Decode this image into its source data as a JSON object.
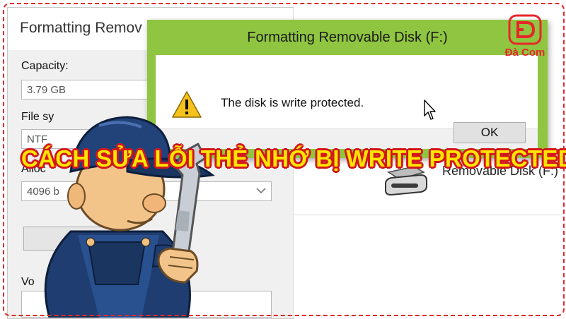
{
  "format_window": {
    "title": "Formatting Remov",
    "capacity_label": "Capacity:",
    "capacity_value": "3.79 GB",
    "filesystem_label": "File sy",
    "filesystem_value": "NTF",
    "allocation_label": "Alloc",
    "allocation_value": "4096 b",
    "volume_label": "Vo"
  },
  "explorer": {
    "drive_label": "Removable Disk (F:)"
  },
  "dialog": {
    "title": "Formatting Removable Disk (F:)",
    "message": "The disk is write protected.",
    "ok_label": "OK",
    "accent_color": "#8fc540"
  },
  "logo": {
    "text": "Đà Com",
    "color": "#e8262a"
  },
  "headline": {
    "text": "CÁCH SỬA LỖI THẺ NHỚ BỊ WRITE PROTECTED",
    "fill_color": "#ffe500",
    "outline_color": "#d2161c"
  },
  "icons": [
    "warning-icon",
    "mouse-cursor-icon",
    "removable-drive-icon",
    "chevron-down-icon",
    "mechanic-illustration"
  ]
}
